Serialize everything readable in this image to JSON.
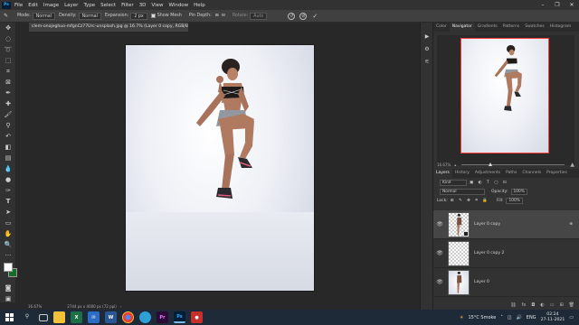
{
  "menu": {
    "logo": "Ps",
    "items": [
      "File",
      "Edit",
      "Image",
      "Layer",
      "Type",
      "Select",
      "Filter",
      "3D",
      "View",
      "Window",
      "Help"
    ]
  },
  "options": {
    "mode_label": "Mode:",
    "mode_value": "Normal",
    "density_label": "Density:",
    "density_value": "Normal",
    "expansion_label": "Expansion:",
    "expansion_value": "2 px",
    "show_mesh": "Show Mesh",
    "pin_depth": "Pin Depth:",
    "rotate": "Rotate:",
    "rotate_value": "Auto"
  },
  "document": {
    "tab_title": "clem-onojeghuo-mfgnCz77Urc-unsplash.jpg @ 16.7% (Layer 0 copy, RGB/8) *",
    "zoom": "16.67%",
    "doc_info": "2744 px x 4000 px (72 ppi)"
  },
  "panels": {
    "top_tabs": [
      "Color",
      "Navigator",
      "Gradients",
      "Patterns",
      "Swatches",
      "Histogram"
    ],
    "nav_zoom": "16.67%",
    "layer_tabs": [
      "Layers",
      "History",
      "Adjustments",
      "Paths",
      "Channels",
      "Properties"
    ],
    "kind_label": "Kind",
    "blend_mode": "Normal",
    "opacity_label": "Opacity:",
    "opacity_value": "100%",
    "lock_label": "Lock:",
    "fill_label": "Fill:",
    "fill_value": "100%",
    "layers": [
      {
        "name": "Layer 0 copy"
      },
      {
        "name": "Layer 0 copy 2"
      },
      {
        "name": "Layer 0"
      }
    ]
  },
  "taskbar": {
    "weather": "15°C  Smoke",
    "lang": "ENG",
    "time": "02:24",
    "date": "27-11-2021"
  }
}
